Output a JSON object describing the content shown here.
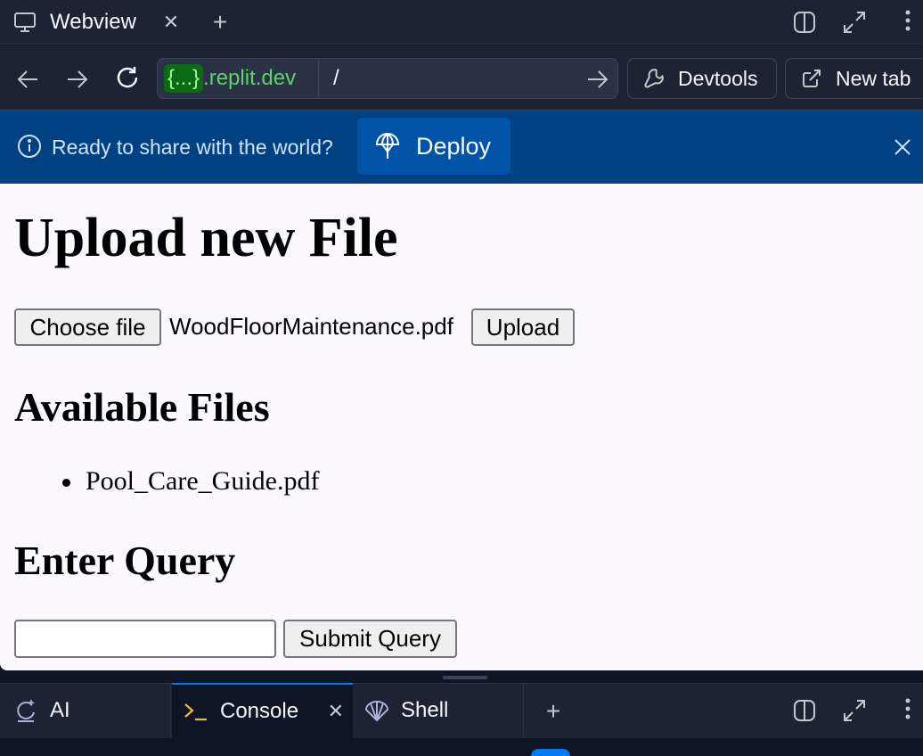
{
  "top_tab": {
    "label": "Webview"
  },
  "nav": {
    "url_domain_badge": "{...}",
    "url_domain": ".replit.dev",
    "url_path": "/",
    "devtools_label": "Devtools",
    "new_tab_label": "New tab"
  },
  "banner": {
    "text": "Ready to share with the world?",
    "deploy_label": "Deploy"
  },
  "page": {
    "title": "Upload new File",
    "choose_file_label": "Choose file",
    "chosen_file": "WoodFloorMaintenance.pdf",
    "upload_label": "Upload",
    "files_heading": "Available Files",
    "files": [
      "Pool_Care_Guide.pdf"
    ],
    "query_heading": "Enter Query",
    "query_value": "",
    "submit_label": "Submit Query"
  },
  "bottom_tabs": {
    "ai": "AI",
    "console": "Console",
    "shell": "Shell"
  },
  "colors": {
    "chrome_bg": "#1c2333",
    "banner_bg": "#004182",
    "deploy_btn": "#0053a6",
    "accent": "#0079f2",
    "domain_green": "#5fd36b"
  },
  "icons": {
    "tab": "monitor-icon",
    "split": "split-view-icon",
    "expand": "expand-icon",
    "more": "more-vertical-icon",
    "back": "arrow-left-icon",
    "forward": "arrow-right-icon",
    "reload": "reload-icon",
    "devtools": "wrench-icon",
    "new_tab": "external-link-icon",
    "info": "info-icon",
    "deploy": "deploy-icon",
    "ai": "ai-sparkle-icon",
    "console": "terminal-prompt-icon",
    "shell": "shell-icon"
  }
}
